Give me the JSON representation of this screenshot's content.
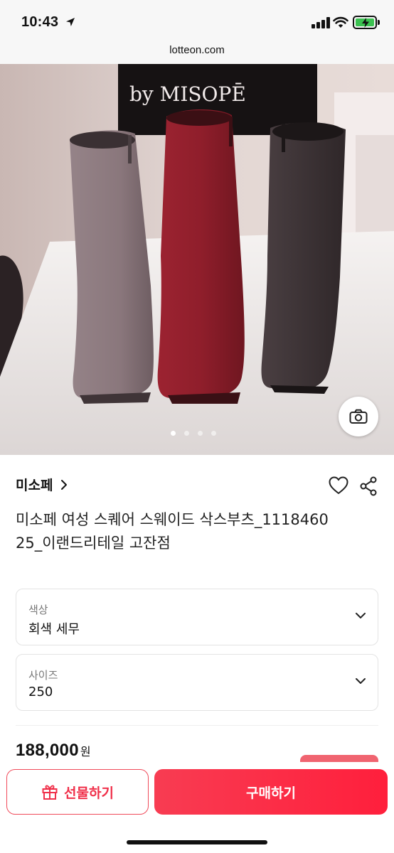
{
  "status_bar": {
    "time": "10:43"
  },
  "browser": {
    "url": "lotteon.com"
  },
  "hero": {
    "sign_text": "by MISOPĒ",
    "carousel_dots": 4,
    "active_dot": 1
  },
  "product": {
    "brand": "미소페",
    "title": "미소페 여성 스퀘어 스웨이드 삭스부츠_111846025_이랜드리테일 고잔점"
  },
  "options": {
    "color": {
      "label": "색상",
      "value": "회색 세무"
    },
    "size": {
      "label": "사이즈",
      "value": "250"
    }
  },
  "price": {
    "amount": "188,000",
    "unit": "원"
  },
  "actions": {
    "gift_label": "선물하기",
    "buy_label": "구매하기"
  },
  "colors": {
    "accent": "#f0304a",
    "buy_button": "#fa2d45"
  },
  "icons": [
    "location-arrow-icon",
    "signal-icon",
    "wifi-icon",
    "battery-icon",
    "camera-icon",
    "chevron-right-icon",
    "heart-icon",
    "share-icon",
    "chevron-down-icon",
    "gift-icon"
  ]
}
